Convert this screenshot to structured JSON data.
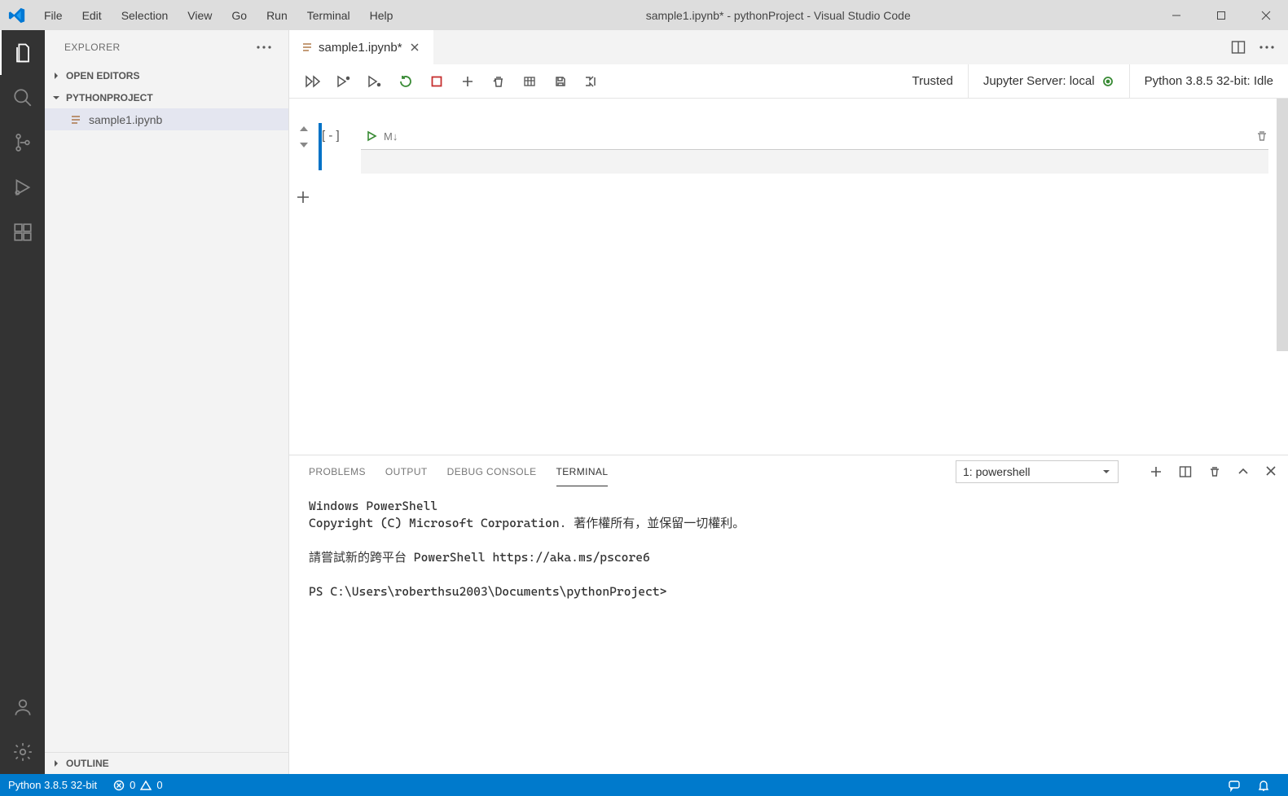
{
  "titlebar": {
    "menus": [
      "File",
      "Edit",
      "Selection",
      "View",
      "Go",
      "Run",
      "Terminal",
      "Help"
    ],
    "title": "sample1.ipynb* - pythonProject - Visual Studio Code"
  },
  "sidebar": {
    "header": "Explorer",
    "sections": {
      "open_editors": "Open Editors",
      "project": "PYTHONPROJECT",
      "outline": "Outline"
    },
    "files": [
      "sample1.ipynb"
    ]
  },
  "tabs": {
    "active": "sample1.ipynb*"
  },
  "notebook": {
    "cell_label": "[ - ]",
    "md_label": "M↓",
    "status_trusted": "Trusted",
    "server": "Jupyter Server: local",
    "interpreter": "Python 3.8.5 32-bit: Idle"
  },
  "panel": {
    "tabs": [
      "Problems",
      "Output",
      "Debug Console",
      "Terminal"
    ],
    "active_tab": "Terminal",
    "selector": "1: powershell",
    "terminal_lines": [
      "Windows PowerShell",
      "Copyright (C) Microsoft Corporation. 著作權所有，並保留一切權利。",
      "",
      "請嘗試新的跨平台 PowerShell https://aka.ms/pscore6",
      "",
      "PS C:\\Users\\roberthsu2003\\Documents\\pythonProject>"
    ]
  },
  "statusbar": {
    "python": "Python 3.8.5 32-bit",
    "errors": "0",
    "warnings": "0"
  }
}
